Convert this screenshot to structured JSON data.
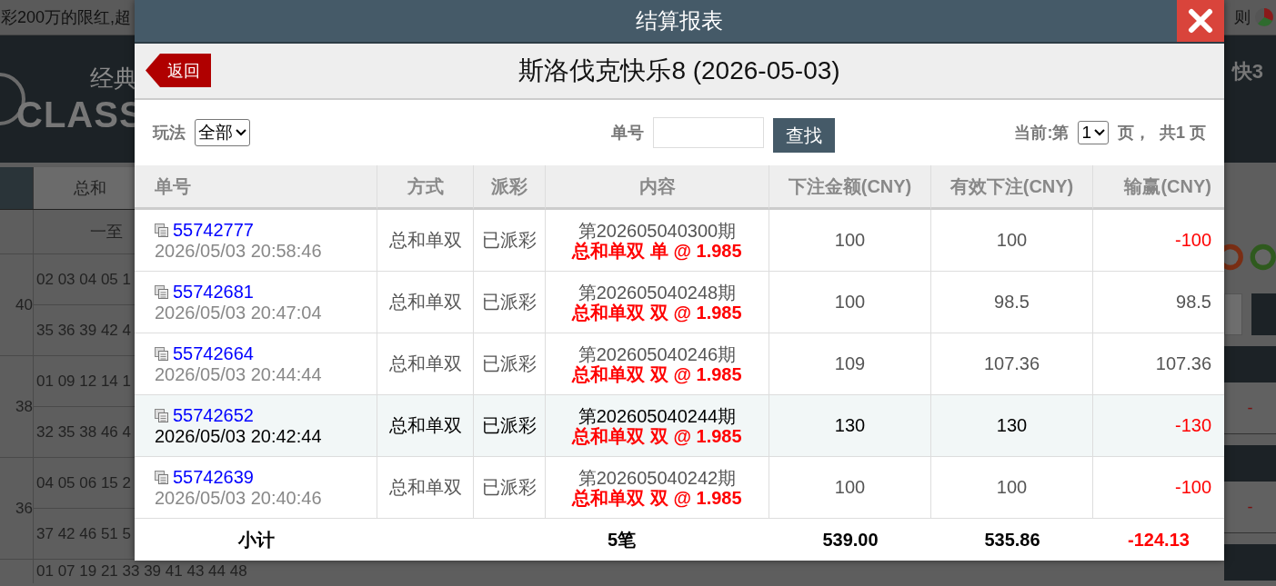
{
  "background": {
    "marquee": "彩200万的限红,超",
    "rules_link": "则",
    "logo": {
      "title": "经典",
      "wordmark": "CLASS"
    },
    "nav_item": "快3",
    "tab": "总和",
    "column_header": "一至",
    "groups": [
      {
        "total": "40",
        "rows": [
          "02 03 04 05 1",
          "35 36 39 42 4"
        ]
      },
      {
        "total": "38",
        "rows": [
          "01 09 12 14 1",
          "32 35 38 46 4"
        ]
      },
      {
        "total": "36",
        "rows": [
          "04 05 06 15 2",
          "37 42 46 51 5"
        ]
      }
    ],
    "last_row": "01 07 19 21 33 39 41 43 44 48",
    "right_cells": [
      "-",
      "-"
    ]
  },
  "dialog": {
    "title": "结算报表",
    "back": "返回",
    "heading": "斯洛伐克快乐8 (2026-05-03)",
    "filters": {
      "play_label": "玩法",
      "play_value": "全部",
      "order_label": "单号",
      "search_button": "查找",
      "page_prefix": "当前:第",
      "page_value": "1",
      "page_suffix": "页，",
      "page_total": "共1 页"
    },
    "columns": [
      "单号",
      "方式",
      "派彩",
      "内容",
      "下注金额(CNY)",
      "有效下注(CNY)",
      "输赢(CNY)"
    ],
    "rows": [
      {
        "order": "55742777",
        "time": "2026/05/03 20:58:46",
        "method": "总和单双",
        "payout": "已派彩",
        "issue": "第202605040300期",
        "bet": "总和单双 单 @ 1.985",
        "amount": "100",
        "valid": "100",
        "result": "-100",
        "loss": true,
        "highlighted": false
      },
      {
        "order": "55742681",
        "time": "2026/05/03 20:47:04",
        "method": "总和单双",
        "payout": "已派彩",
        "issue": "第202605040248期",
        "bet": "总和单双 双 @ 1.985",
        "amount": "100",
        "valid": "98.5",
        "result": "98.5",
        "loss": false,
        "highlighted": false
      },
      {
        "order": "55742664",
        "time": "2026/05/03 20:44:44",
        "method": "总和单双",
        "payout": "已派彩",
        "issue": "第202605040246期",
        "bet": "总和单双 双 @ 1.985",
        "amount": "109",
        "valid": "107.36",
        "result": "107.36",
        "loss": false,
        "highlighted": false
      },
      {
        "order": "55742652",
        "time": "2026/05/03 20:42:44",
        "method": "总和单双",
        "payout": "已派彩",
        "issue": "第202605040244期",
        "bet": "总和单双 双 @ 1.985",
        "amount": "130",
        "valid": "130",
        "result": "-130",
        "loss": true,
        "highlighted": true
      },
      {
        "order": "55742639",
        "time": "2026/05/03 20:40:46",
        "method": "总和单双",
        "payout": "已派彩",
        "issue": "第202605040242期",
        "bet": "总和单双 双 @ 1.985",
        "amount": "100",
        "valid": "100",
        "result": "-100",
        "loss": true,
        "highlighted": false
      }
    ],
    "footer": {
      "label": "小计",
      "count": "5笔",
      "amount": "539.00",
      "valid": "535.86",
      "result": "-124.13",
      "loss": true
    }
  }
}
